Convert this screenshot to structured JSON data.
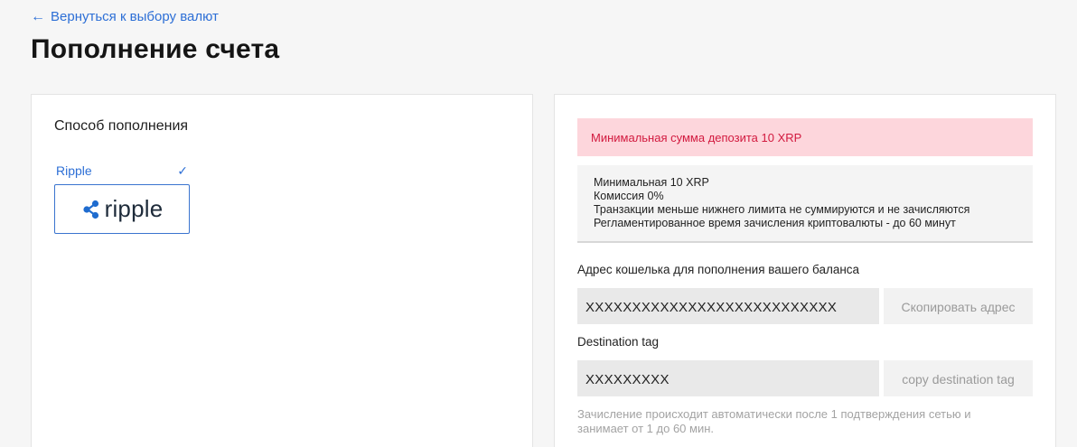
{
  "back_link": {
    "arrow": "←",
    "label": "Вернуться к выбору валют"
  },
  "page_title": "Пополнение счета",
  "method": {
    "title": "Способ пополнения",
    "option_label": "Ripple",
    "check": "✓",
    "logo_text": "ripple",
    "logo_icon": "ripple-logo-icon"
  },
  "deposit": {
    "alert": "Минимальная сумма депозита 10 XRP",
    "info_lines": [
      "Минимальная 10 XRP",
      "Комиссия 0%",
      "Транзакции меньше нижнего лимита не суммируются и не зачисляются",
      "Регламентированное время зачисления криптовалюты - до 60 минут"
    ],
    "address_label": "Адрес кошелька для пополнения вашего баланса",
    "address_value": "XXXXXXXXXXXXXXXXXXXXXXXXXXX",
    "copy_address_label": "Скопировать адрес",
    "tag_label": "Destination tag",
    "tag_value": "XXXXXXXXX",
    "copy_tag_label": "copy destination tag",
    "note": "Зачисление происходит автоматически после 1 подтверждения сетью и занимает от 1 до 60 мин."
  },
  "colors": {
    "accent": "#2d6fd6",
    "alert_bg": "#fdd6dc",
    "alert_text": "#d21a3f"
  }
}
